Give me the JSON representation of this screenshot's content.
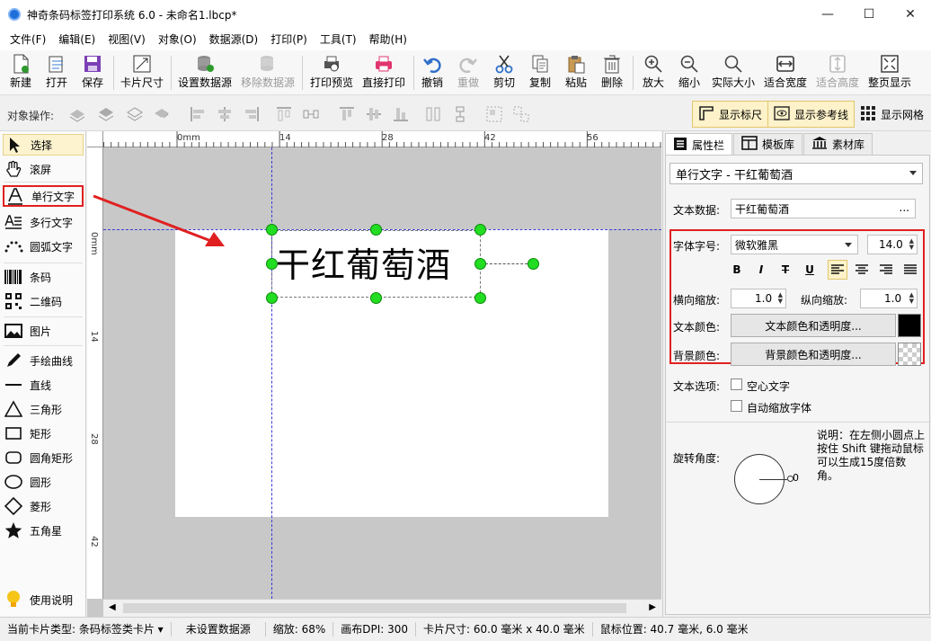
{
  "window": {
    "title": "神奇条码标签打印系统 6.0 - 未命名1.lbcp*",
    "minimize": "—",
    "maximize": "☐",
    "close": "✕"
  },
  "menu": [
    "文件(F)",
    "编辑(E)",
    "视图(V)",
    "对象(O)",
    "数据源(D)",
    "打印(P)",
    "工具(T)",
    "帮助(H)"
  ],
  "toolbar": {
    "new": "新建",
    "open": "打开",
    "save": "保存",
    "card_size": "卡片尺寸",
    "set_datasource": "设置数据源",
    "remove_datasource": "移除数据源",
    "print_preview": "打印预览",
    "direct_print": "直接打印",
    "undo": "撤销",
    "redo": "重做",
    "cut": "剪切",
    "copy": "复制",
    "paste": "粘贴",
    "delete": "删除",
    "zoom_in": "放大",
    "zoom_out": "缩小",
    "actual_size": "实际大小",
    "fit_width": "适合宽度",
    "fit_height": "适合高度",
    "full_page": "整页显示"
  },
  "objbar": {
    "label": "对象操作:",
    "show_ruler": "显示标尺",
    "show_guides": "显示参考线",
    "show_grid": "显示网格"
  },
  "tools": {
    "select": "选择",
    "scroll": "滚屏",
    "single_line_text": "单行文字",
    "multi_line_text": "多行文字",
    "arc_text": "圆弧文字",
    "barcode": "条码",
    "qrcode": "二维码",
    "image": "图片",
    "freehand": "手绘曲线",
    "line": "直线",
    "triangle": "三角形",
    "rect": "矩形",
    "rounded_rect": "圆角矩形",
    "circle": "圆形",
    "diamond": "菱形",
    "star": "五角星",
    "help": "使用说明"
  },
  "ruler": {
    "top": [
      "0mm",
      "14",
      "28",
      "42",
      "56"
    ],
    "left": [
      "0mm",
      "14",
      "28",
      "42"
    ]
  },
  "canvas": {
    "text": "干红葡萄酒"
  },
  "props": {
    "tabs": [
      "属性栏",
      "模板库",
      "素材库"
    ],
    "object": "单行文字 - 干红葡萄酒",
    "text_data_label": "文本数据:",
    "text_data": "干红葡萄酒",
    "ellipsis": "...",
    "font_label": "字体字号:",
    "font": "微软雅黑",
    "font_size": "14.0",
    "bold": "B",
    "italic": "I",
    "strike": "T",
    "underline": "U",
    "hscale_label": "横向缩放:",
    "hscale": "1.0",
    "vscale_label": "纵向缩放:",
    "vscale": "1.0",
    "text_color_label": "文本颜色:",
    "text_color_btn": "文本颜色和透明度...",
    "bg_color_label": "背景颜色:",
    "bg_color_btn": "背景颜色和透明度...",
    "text_options_label": "文本选项:",
    "hollow": "空心文字",
    "auto_shrink": "自动缩放字体",
    "rotate_label": "旋转角度:",
    "rotate_value": "0",
    "rotate_note": "说明：在左侧小圆点上按住 Shift 键拖动鼠标可以生成15度倍数角。"
  },
  "status": {
    "card_type": "当前卡片类型: 条码标签类卡片 ▾",
    "datasource": "未设置数据源",
    "zoom": "缩放: 68%",
    "dpi": "画布DPI: 300",
    "card_size": "卡片尺寸: 60.0 毫米 x 40.0 毫米",
    "mouse": "鼠标位置: 40.7 毫米, 6.0 毫米"
  },
  "colors": {
    "accent_red": "#e02020",
    "handle_green": "#22dd22",
    "highlight": "#fdf2c9"
  }
}
